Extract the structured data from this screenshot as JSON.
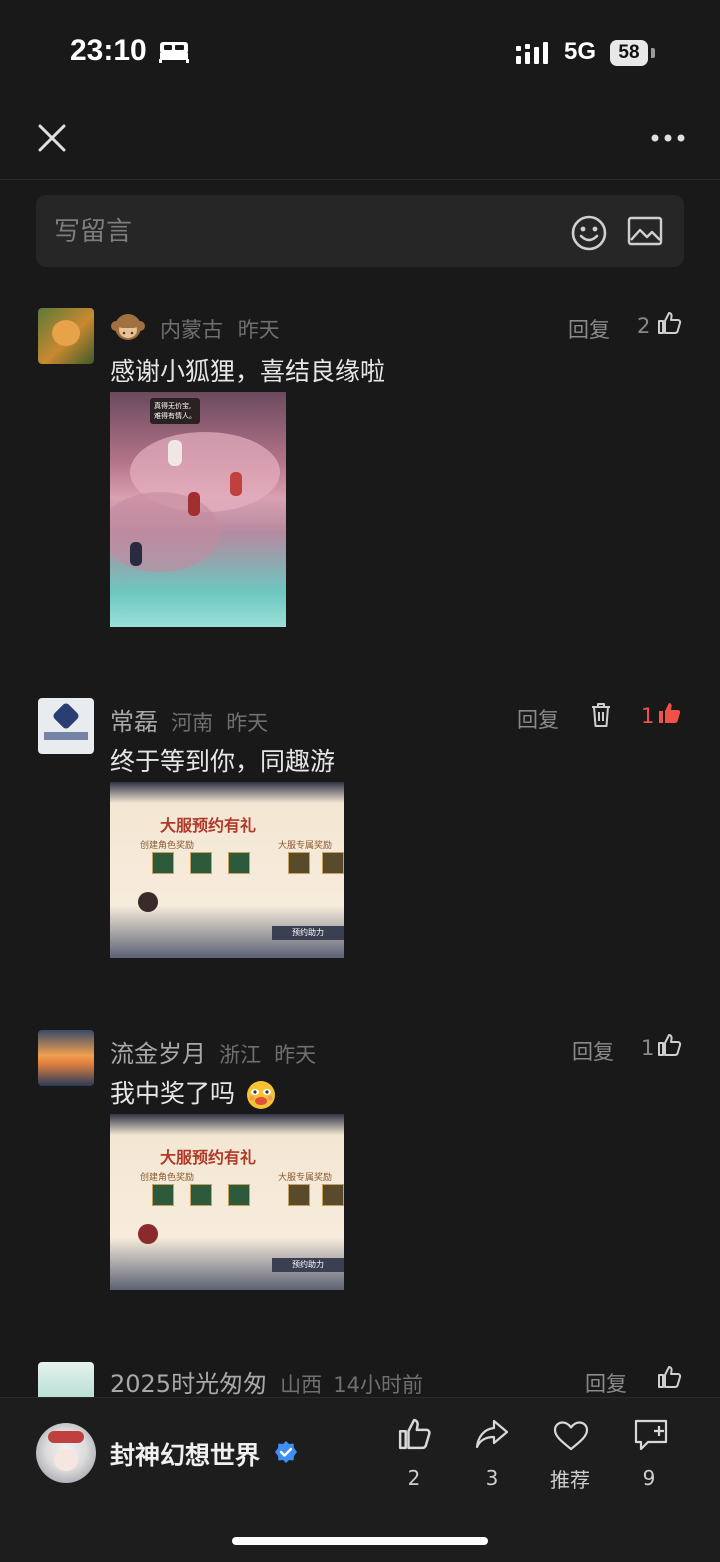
{
  "status": {
    "time": "23:10",
    "network": "5G",
    "battery": "58"
  },
  "composer": {
    "placeholder": "写留言"
  },
  "comments": [
    {
      "name": "",
      "region": "内蒙古",
      "time": "昨天",
      "text": "感谢小狐狸，喜结良缘啦",
      "reply": "回复",
      "likes": "2",
      "liked": false,
      "image_text": [
        "真得无价宝,",
        "难得有情人。"
      ]
    },
    {
      "name": "常磊",
      "region": "河南",
      "time": "昨天",
      "text": "终于等到你，同趣游",
      "reply": "回复",
      "likes": "1",
      "liked": true,
      "image_text": {
        "title": "大服预约有礼",
        "left": "创建角色奖励",
        "right": "大服专属奖励",
        "button": "预约助力"
      }
    },
    {
      "name": "流金岁月",
      "region": "浙江",
      "time": "昨天",
      "text": "我中奖了吗",
      "reply": "回复",
      "likes": "1",
      "liked": false,
      "image_text": {
        "title": "大服预约有礼",
        "left": "创建角色奖励",
        "right": "大服专属奖励",
        "button": "预约助力"
      }
    },
    {
      "name": "2025时光匆匆",
      "region": "山西",
      "time": "14小时前",
      "reply": "回复",
      "likes": ""
    }
  ],
  "account": {
    "name": "封神幻想世界"
  },
  "actions": {
    "like_count": "2",
    "share_count": "3",
    "recommend_label": "推荐",
    "comment_count": "9"
  },
  "colors": {
    "accent_like": "#f0524a",
    "verified": "#3f8ef6",
    "background": "#191919"
  }
}
